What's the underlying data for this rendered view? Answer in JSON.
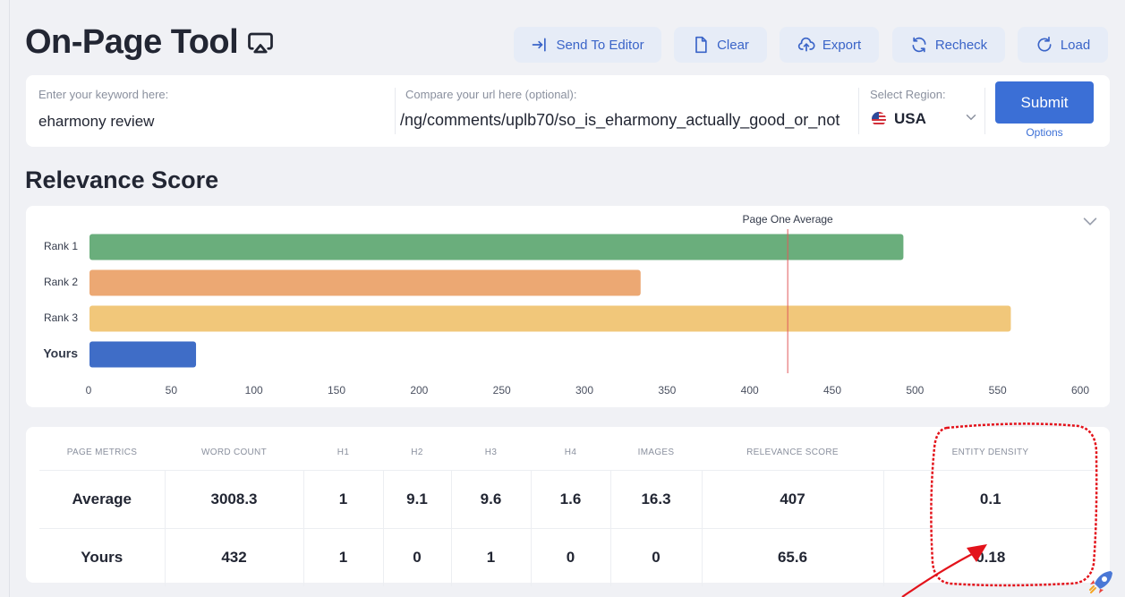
{
  "page": {
    "title": "On-Page Tool",
    "section_title": "Relevance Score"
  },
  "toolbar": {
    "send_to_editor": "Send To Editor",
    "clear": "Clear",
    "export": "Export",
    "recheck": "Recheck",
    "load": "Load"
  },
  "search": {
    "keyword_label": "Enter your keyword here:",
    "keyword_value": "eharmony review",
    "url_label": "Compare your url here (optional):",
    "url_value": "ng/comments/uplb70/so_is_eharmony_actually_good_or_not/",
    "region_label": "Select Region:",
    "region_value": "USA",
    "submit_label": "Submit",
    "options_label": "Options"
  },
  "chart_data": {
    "type": "bar",
    "orientation": "horizontal",
    "categories": [
      "Rank 1",
      "Rank 2",
      "Rank 3",
      "Yours"
    ],
    "values": [
      493,
      334,
      558,
      65
    ],
    "colors": [
      "#6aae7c",
      "#eca873",
      "#f1c77a",
      "#3f6dc7"
    ],
    "xlim": [
      0,
      600
    ],
    "ticks": [
      "0",
      "50",
      "100",
      "150",
      "200",
      "250",
      "300",
      "350",
      "400",
      "450",
      "500",
      "550",
      "600"
    ],
    "reference_line": {
      "label": "Page One Average",
      "value": 423,
      "color": "#e0595a"
    },
    "grid": false
  },
  "metrics": {
    "headers": [
      "Page Metrics",
      "Word Count",
      "H1",
      "H2",
      "H3",
      "H4",
      "Images",
      "Relevance Score",
      "Entity Density"
    ],
    "rows": [
      [
        "Average",
        "3008.3",
        "1",
        "9.1",
        "9.6",
        "1.6",
        "16.3",
        "407",
        "0.1"
      ],
      [
        "Yours",
        "432",
        "1",
        "0",
        "1",
        "0",
        "0",
        "65.6",
        "0.18"
      ]
    ]
  },
  "colors": {
    "accent": "#3b6fd6",
    "button_bg": "#e6ecf7",
    "annotation": "#e3131b"
  }
}
